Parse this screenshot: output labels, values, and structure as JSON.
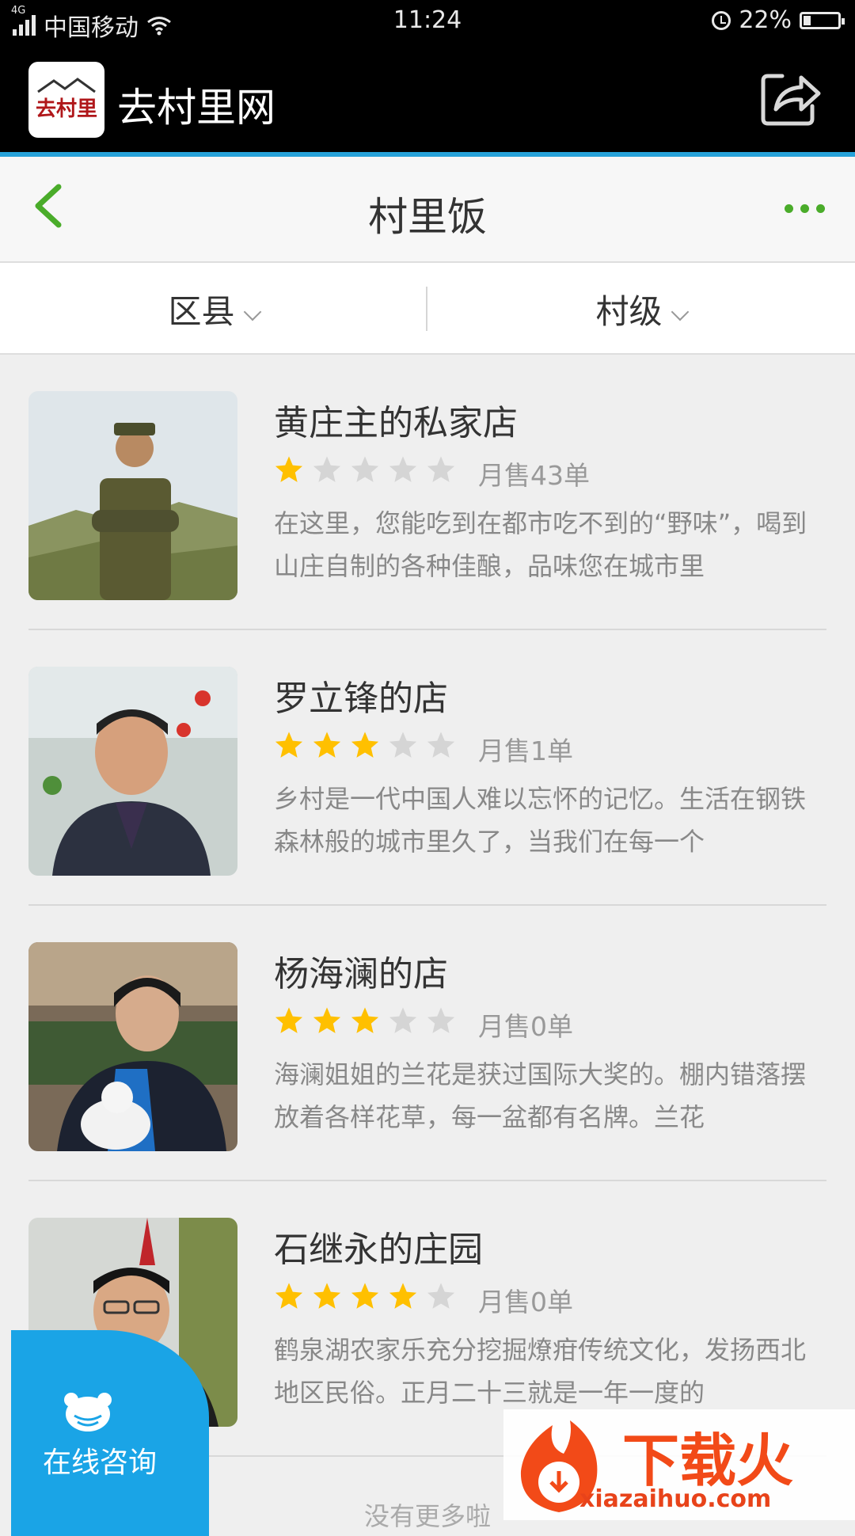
{
  "status_bar": {
    "network": "4G",
    "carrier": "中国移动",
    "time": "11:24",
    "battery": "22%",
    "battery_level": 0.22
  },
  "app_header": {
    "logo_text": "去村里",
    "app_name": "去村里网",
    "share_icon": "share-icon"
  },
  "nav": {
    "title": "村里饭",
    "back_icon": "chevron-left-icon",
    "more_icon": "more-dots-icon",
    "accent_color": "#4aac2a"
  },
  "filters": [
    {
      "label": "区县"
    },
    {
      "label": "村级"
    }
  ],
  "shops": [
    {
      "name": "黄庄主的私家店",
      "rating": 1,
      "sales": "月售43单",
      "description": "在这里，您能吃到在都市吃不到的“野味”，喝到山庄自制的各种佳酿，品味您在城市里"
    },
    {
      "name": "罗立锋的店",
      "rating": 3,
      "sales": "月售1单",
      "description": "乡村是一代中国人难以忘怀的记忆。生活在钢铁森林般的城市里久了，当我们在每一个"
    },
    {
      "name": "杨海澜的店",
      "rating": 3,
      "sales": "月售0单",
      "description": "海澜姐姐的兰花是获过国际大奖的。棚内错落摆放着各样花草，每一盆都有名牌。兰花"
    },
    {
      "name": "石继永的庄园",
      "rating": 4,
      "sales": "月售0单",
      "description": "鹤泉湖农家乐充分挖掘燎疳传统文化，发扬西北地区民俗。正月二十三就是一年一度的"
    }
  ],
  "end_message": "没有更多啦",
  "consult": {
    "label": "在线咨询",
    "color": "#1aa4e6"
  },
  "watermark": {
    "text": "下载火",
    "url": "xiazaihuo.com"
  },
  "colors": {
    "star_on": "#ffc000",
    "star_off": "#d5d5d5",
    "header_blue": "#27a2d9"
  }
}
